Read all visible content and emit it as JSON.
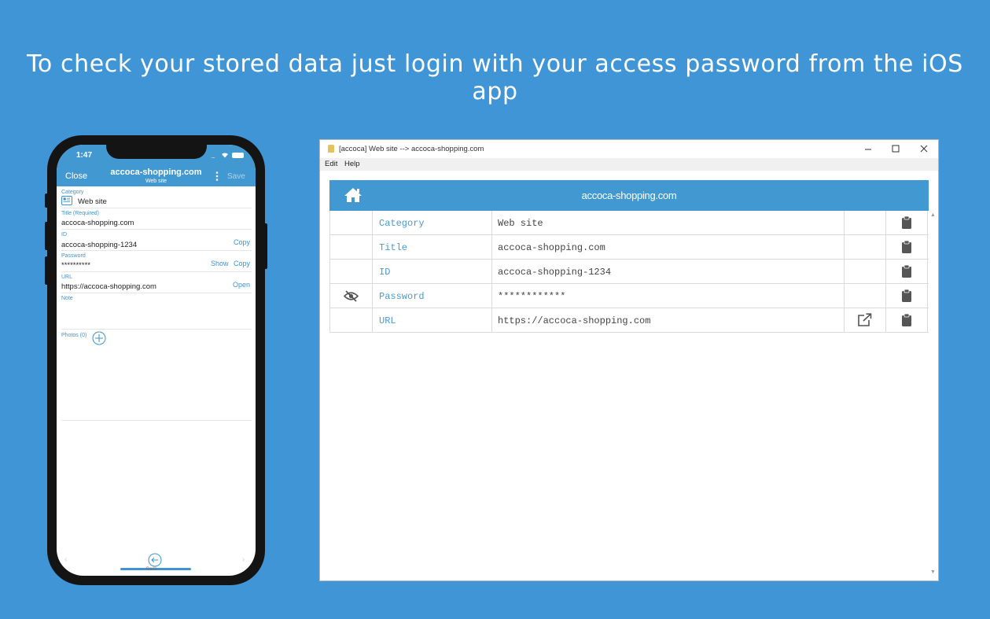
{
  "headline": "To check your stored data just login with your access password from the iOS app",
  "phone": {
    "status_time": "1:47",
    "close_label": "Close",
    "nav_title": "accoca-shopping.com",
    "nav_subtitle": "Web site",
    "save_label": "Save",
    "fields": {
      "category": {
        "label": "Category",
        "value": "Web site"
      },
      "title": {
        "label": "Title (Required)",
        "value": "accoca-shopping.com"
      },
      "id": {
        "label": "ID",
        "value": "accoca-shopping-1234",
        "copy": "Copy"
      },
      "password": {
        "label": "Password",
        "value": "**********",
        "show": "Show",
        "copy": "Copy"
      },
      "url": {
        "label": "URL",
        "value": "https://accoca-shopping.com",
        "open": "Open"
      },
      "note": {
        "label": "Note"
      },
      "photos": {
        "label": "Photos (0)"
      }
    },
    "back_label": "Back"
  },
  "window": {
    "title": "[accoca]  Web site  -->  accoca-shopping.com",
    "menu": [
      "Edit",
      "Help"
    ],
    "record_title": "accoca-shopping.com",
    "rows": [
      {
        "label": "Category",
        "value": "Web site"
      },
      {
        "label": "Title",
        "value": "accoca-shopping.com"
      },
      {
        "label": "ID",
        "value": "accoca-shopping-1234"
      },
      {
        "label": "Password",
        "value": "************"
      },
      {
        "label": "URL",
        "value": "https://accoca-shopping.com"
      }
    ]
  },
  "colors": {
    "background": "#3f95d5",
    "header": "#4299d2",
    "accent": "#3d93d3"
  }
}
